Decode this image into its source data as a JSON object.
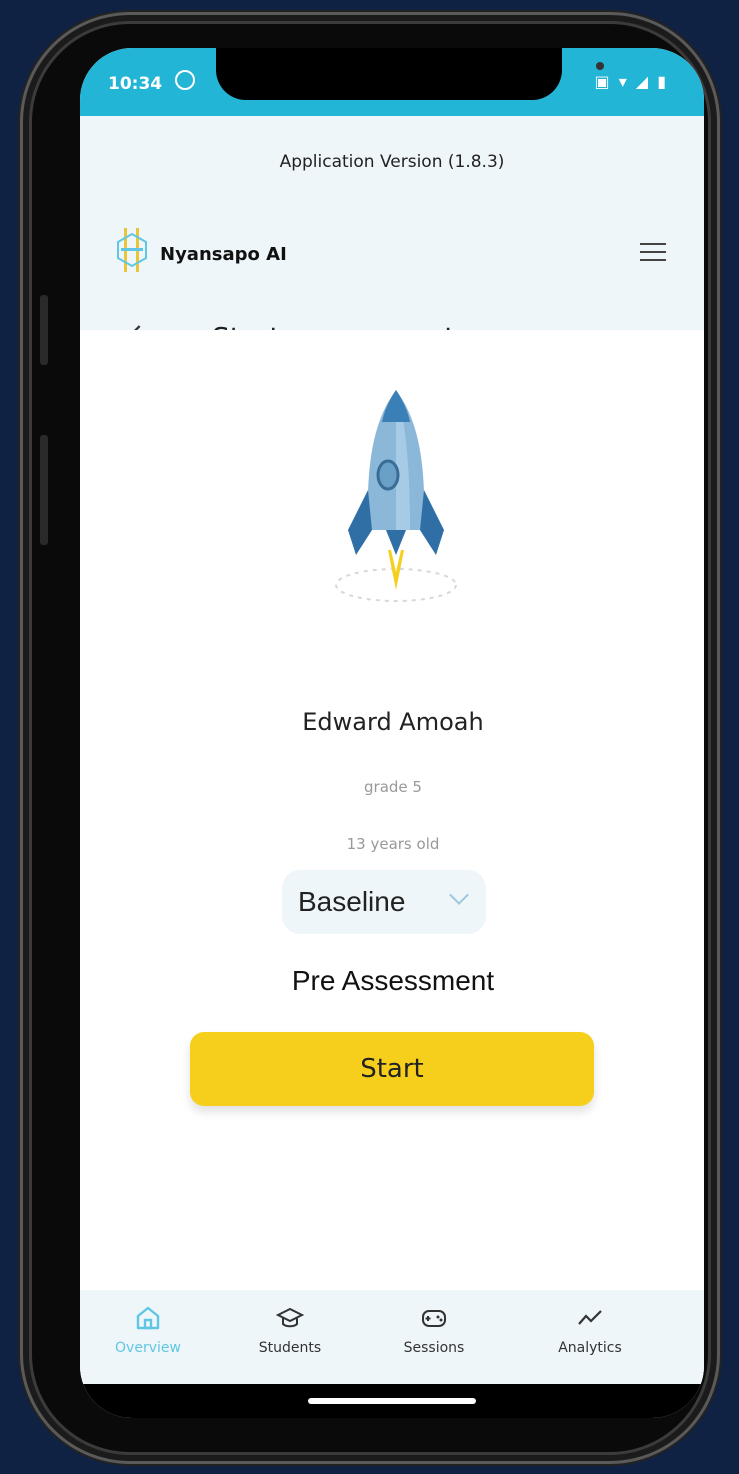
{
  "status": {
    "time": "10:34"
  },
  "header": {
    "version": "Application Version (1.8.3)",
    "brand": "Nyansapo AI",
    "title": "Start assessment"
  },
  "student": {
    "name": "Edward Amoah",
    "grade": "grade 5",
    "age": "13 years old"
  },
  "assessment": {
    "type_selected": "Baseline",
    "subtitle": "Pre Assessment",
    "start_label": "Start"
  },
  "nav": {
    "items": [
      {
        "label": "Overview",
        "icon": "home-icon",
        "active": true
      },
      {
        "label": "Students",
        "icon": "graduation-cap-icon",
        "active": false
      },
      {
        "label": "Sessions",
        "icon": "gamepad-icon",
        "active": false
      },
      {
        "label": "Analytics",
        "icon": "trend-line-icon",
        "active": false
      }
    ]
  },
  "colors": {
    "statusbar": "#22b5d5",
    "accent": "#5fc7e4",
    "button": "#f6cf1d",
    "header_bg": "#eef6fa"
  }
}
